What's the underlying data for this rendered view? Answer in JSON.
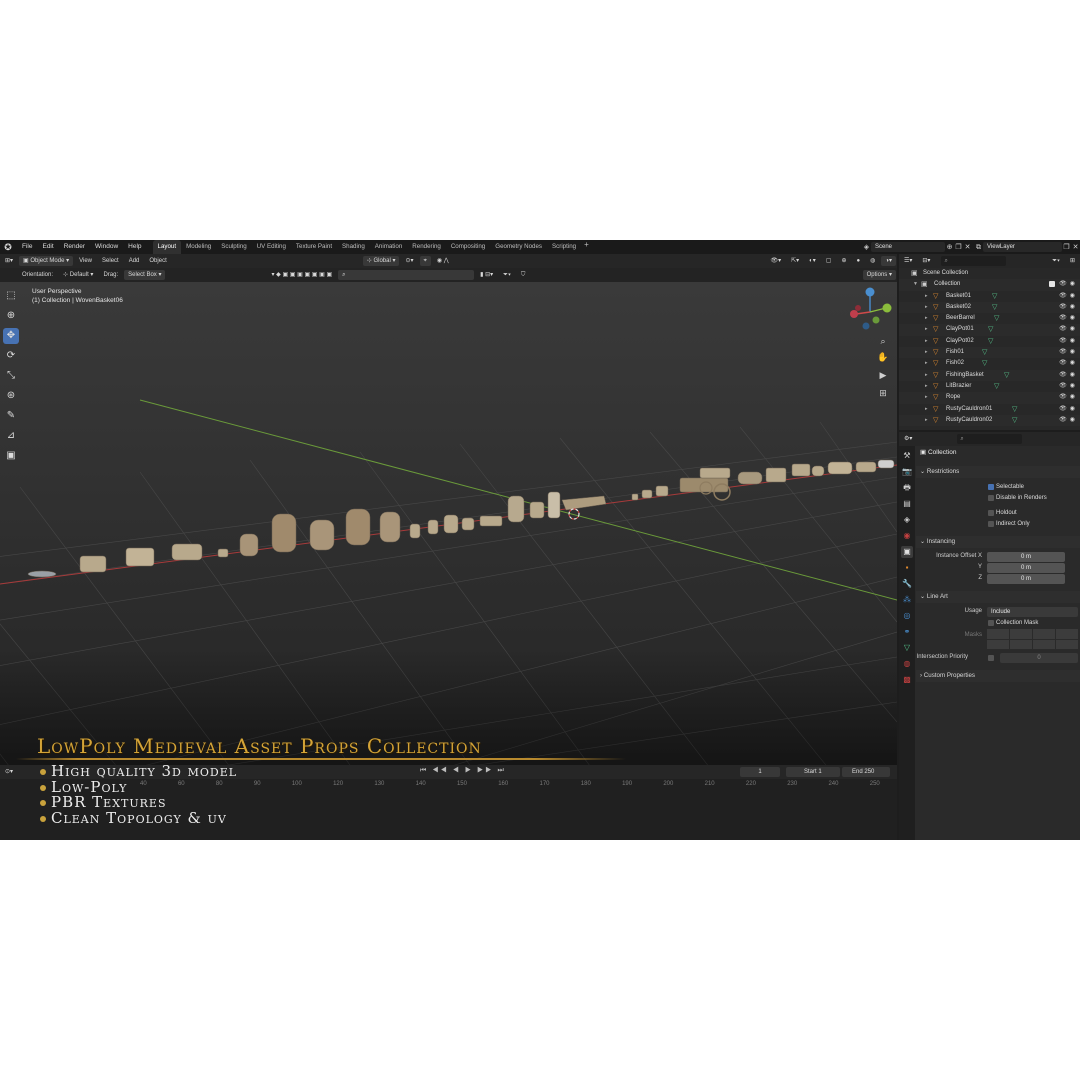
{
  "menubar": {
    "items": [
      "File",
      "Edit",
      "Render",
      "Window",
      "Help"
    ],
    "workspaces": [
      "Layout",
      "Modeling",
      "Sculpting",
      "UV Editing",
      "Texture Paint",
      "Shading",
      "Animation",
      "Rendering",
      "Compositing",
      "Geometry Nodes",
      "Scripting"
    ],
    "active_workspace": "Layout",
    "add": "+",
    "scene": "Scene",
    "view_layer": "ViewLayer"
  },
  "viewport_header": {
    "mode": "Object Mode",
    "menus": [
      "View",
      "Select",
      "Add",
      "Object"
    ],
    "transform_orientation": "Global"
  },
  "tool_settings": {
    "orientation_label": "Orientation:",
    "orientation_value": "Default",
    "drag_label": "Drag:",
    "drag_value": "Select Box",
    "options": "Options"
  },
  "viewport": {
    "view_name": "User Perspective",
    "collection_info": "(1) Collection | WovenBasket06"
  },
  "overlay": {
    "title": "LowPoly Medieval Asset Props Collection",
    "bullets": [
      "High quality 3d model",
      "Low-Poly",
      "PBR Textures",
      "Clean Topology & uv"
    ]
  },
  "timeline": {
    "current_frame": "1",
    "start_label": "Start",
    "start_value": "1",
    "end_label": "End",
    "end_value": "250",
    "ticks": [
      "40",
      "60",
      "80",
      "90",
      "100",
      "120",
      "130",
      "140",
      "150",
      "160",
      "170",
      "180",
      "190",
      "200",
      "210",
      "220",
      "230",
      "240",
      "250"
    ]
  },
  "outliner": {
    "scene_collection": "Scene Collection",
    "collection": "Collection",
    "objects": [
      "Basket01",
      "Basket02",
      "BeerBarrel",
      "ClayPot01",
      "ClayPot02",
      "Fish01",
      "Fish02",
      "FishingBasket",
      "LitBrazier",
      "Rope",
      "RustyCauldron01",
      "RustyCauldron02"
    ]
  },
  "properties": {
    "context_title": "Collection",
    "restrictions": {
      "header": "Restrictions",
      "selectable": "Selectable",
      "disable_in_renders": "Disable in Renders",
      "holdout": "Holdout",
      "indirect_only": "Indirect Only"
    },
    "instancing": {
      "header": "Instancing",
      "offset_x_label": "Instance Offset X",
      "y_label": "Y",
      "z_label": "Z",
      "x_value": "0 m",
      "y_value": "0 m",
      "z_value": "0 m"
    },
    "line_art": {
      "header": "Line Art",
      "usage_label": "Usage",
      "usage_value": "Include",
      "collection_mask": "Collection Mask",
      "masks_label": "Masks",
      "intersection_priority_label": "Intersection Priority",
      "intersection_priority_value": "0"
    },
    "custom_properties": "Custom Properties"
  },
  "colors": {
    "accent_blue": "#4772b3",
    "title_gold": "#d4a437",
    "object_orange": "#e08a2e",
    "mesh_green": "#55c28a",
    "x_axis_red": "#a83a3a",
    "y_axis_green": "#6a9a3a"
  }
}
